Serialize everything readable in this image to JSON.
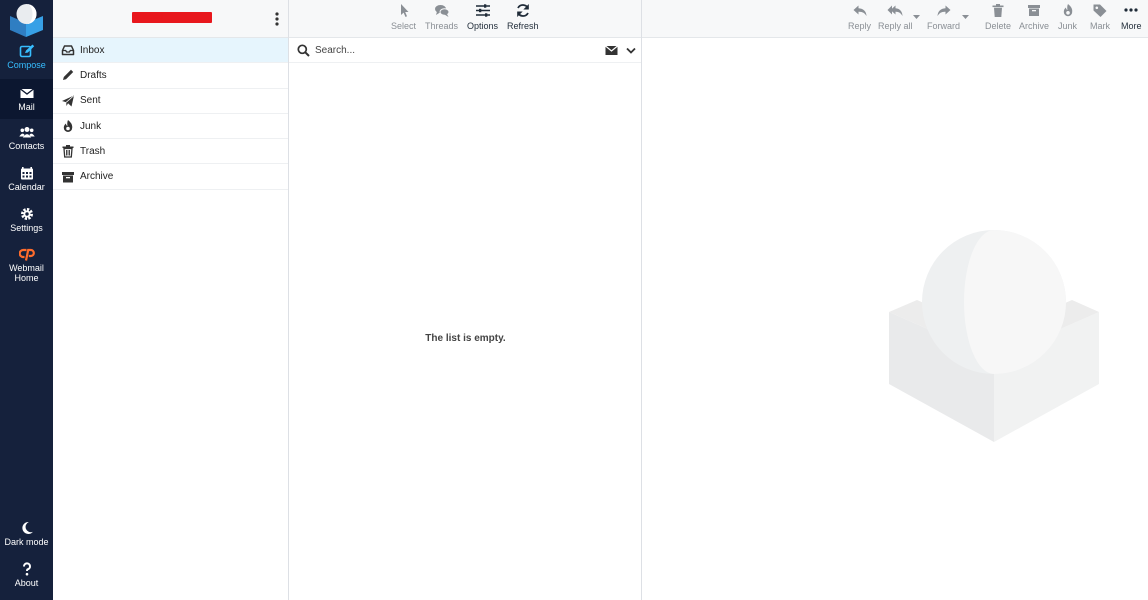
{
  "rail": {
    "items": [
      {
        "label": "Compose",
        "icon": "compose-icon"
      },
      {
        "label": "Mail",
        "icon": "envelope-icon"
      },
      {
        "label": "Contacts",
        "icon": "users-icon"
      },
      {
        "label": "Calendar",
        "icon": "calendar-icon"
      },
      {
        "label": "Settings",
        "icon": "gear-icon"
      },
      {
        "label": "Webmail Home",
        "icon": "cpanel-icon"
      },
      {
        "label": "Dark mode",
        "icon": "moon-icon"
      },
      {
        "label": "About",
        "icon": "question-icon"
      }
    ],
    "accent": "#37beff",
    "background": "#15213c"
  },
  "folders": {
    "account": "redacted",
    "items": [
      {
        "label": "Inbox",
        "icon": "inbox-icon"
      },
      {
        "label": "Drafts",
        "icon": "pencil-icon"
      },
      {
        "label": "Sent",
        "icon": "paper-plane-icon"
      },
      {
        "label": "Junk",
        "icon": "fire-icon"
      },
      {
        "label": "Trash",
        "icon": "trash-icon"
      },
      {
        "label": "Archive",
        "icon": "archive-icon"
      }
    ],
    "selected_color": "#e6f5fd"
  },
  "list": {
    "toolbar": [
      {
        "label": "Select",
        "icon": "cursor-icon"
      },
      {
        "label": "Threads",
        "icon": "comments-icon"
      },
      {
        "label": "Options",
        "icon": "sliders-icon"
      },
      {
        "label": "Refresh",
        "icon": "refresh-icon"
      }
    ],
    "search_placeholder": "Search...",
    "empty_text": "The list is empty."
  },
  "content": {
    "toolbar": [
      {
        "label": "Reply",
        "icon": "reply-icon"
      },
      {
        "label": "Reply all",
        "icon": "reply-all-icon"
      },
      {
        "label": "Forward",
        "icon": "forward-icon"
      },
      {
        "label": "Delete",
        "icon": "trash-icon"
      },
      {
        "label": "Archive",
        "icon": "archive-icon"
      },
      {
        "label": "Junk",
        "icon": "fire-icon"
      },
      {
        "label": "Mark",
        "icon": "tag-icon"
      },
      {
        "label": "More",
        "icon": "dots-icon"
      }
    ]
  }
}
